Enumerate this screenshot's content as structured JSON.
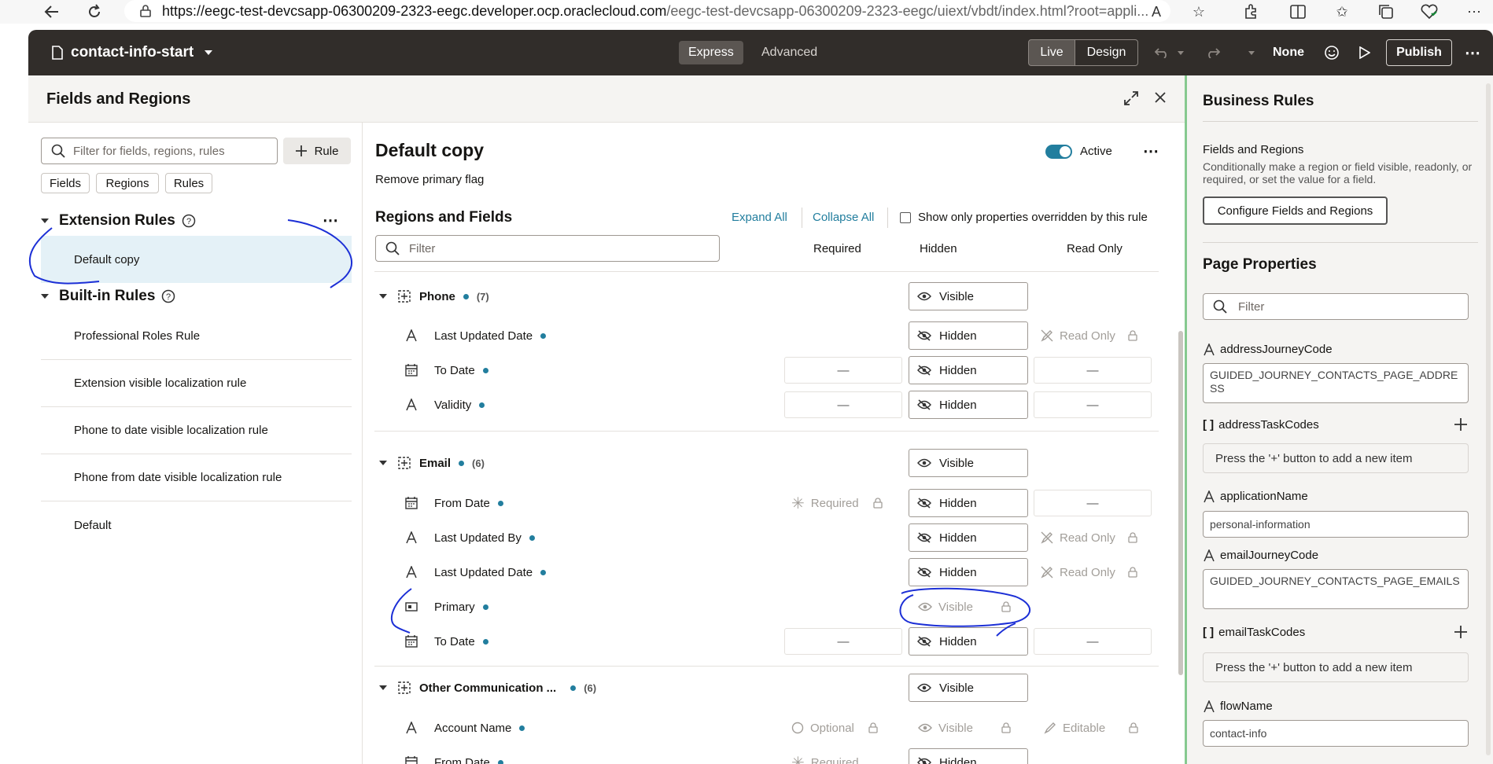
{
  "browser": {
    "url_host": "https://eegc-test-devcsapp-06300209-2323-eegc.developer.ocp.oraclecloud.com",
    "url_path": "/eegc-test-devcsapp-06300209-2323-eegc/uiext/vbdt/index.html?root=appli..."
  },
  "header": {
    "title": "contact-info-start",
    "express": "Express",
    "advanced": "Advanced",
    "live": "Live",
    "design": "Design",
    "none": "None",
    "publish": "Publish"
  },
  "fields_panel": {
    "title": "Fields and Regions"
  },
  "left": {
    "filter_placeholder": "Filter for fields, regions, rules",
    "rule_button": "Rule",
    "chips": [
      "Fields",
      "Regions",
      "Rules"
    ],
    "extension_title": "Extension Rules",
    "extension_items": [
      "Default copy"
    ],
    "builtin_title": "Built-in Rules",
    "builtin_items": [
      "Professional Roles Rule",
      "Extension visible localization rule",
      "Phone to date visible localization rule",
      "Phone from date visible localization rule",
      "Default"
    ]
  },
  "main": {
    "rule_title": "Default copy",
    "active_label": "Active",
    "description": "Remove primary flag",
    "section_title": "Regions and Fields",
    "expand_all": "Expand All",
    "collapse_all": "Collapse All",
    "show_only": "Show only properties overridden by this rule",
    "filter_placeholder": "Filter",
    "col_required": "Required",
    "col_hidden": "Hidden",
    "col_readonly": "Read Only",
    "phone": {
      "name": "Phone",
      "count": "(7)",
      "state": "Visible"
    },
    "phone_rows": [
      {
        "name": "Last Updated Date",
        "hidden": "Hidden",
        "readonly": "Read Only"
      },
      {
        "name": "To Date",
        "required": "—",
        "hidden": "Hidden",
        "readonly": "—"
      },
      {
        "name": "Validity",
        "required": "—",
        "hidden": "Hidden",
        "readonly": "—"
      }
    ],
    "email": {
      "name": "Email",
      "count": "(6)",
      "state": "Visible"
    },
    "email_rows": [
      {
        "name": "From Date",
        "required": "Required",
        "hidden": "Hidden",
        "readonly": "—"
      },
      {
        "name": "Last Updated By",
        "hidden": "Hidden",
        "readonly": "Read Only"
      },
      {
        "name": "Last Updated Date",
        "hidden": "Hidden",
        "readonly": "Read Only"
      },
      {
        "name": "Primary",
        "hidden": "Visible"
      },
      {
        "name": "To Date",
        "required": "—",
        "hidden": "Hidden",
        "readonly": "—"
      }
    ],
    "other": {
      "name": "Other Communication ...",
      "count": "(6)",
      "state": "Visible"
    },
    "other_rows": [
      {
        "name": "Account Name",
        "required": "Optional",
        "hidden": "Visible",
        "readonly": "Editable"
      },
      {
        "name": "From Date",
        "required": "Required",
        "hidden": "Hidden"
      }
    ]
  },
  "right": {
    "business_rules": "Business Rules",
    "fr_title": "Fields and Regions",
    "fr_desc": "Conditionally make a region or field visible, readonly, or required, or set the value for a field.",
    "configure_button": "Configure Fields and Regions",
    "page_properties": "Page Properties",
    "filter_placeholder": "Filter",
    "props": [
      {
        "name": "addressJourneyCode",
        "value": "GUIDED_JOURNEY_CONTACTS_PAGE_ADDRESS"
      },
      {
        "name": "addressTaskCodes",
        "value": "Press the '+' button to add a new item"
      },
      {
        "name": "applicationName",
        "value": "personal-information"
      },
      {
        "name": "emailJourneyCode",
        "value": "GUIDED_JOURNEY_CONTACTS_PAGE_EMAILS"
      },
      {
        "name": "emailTaskCodes",
        "value": "Press the '+' button to add a new item"
      },
      {
        "name": "flowName",
        "value": "contact-info"
      }
    ]
  }
}
